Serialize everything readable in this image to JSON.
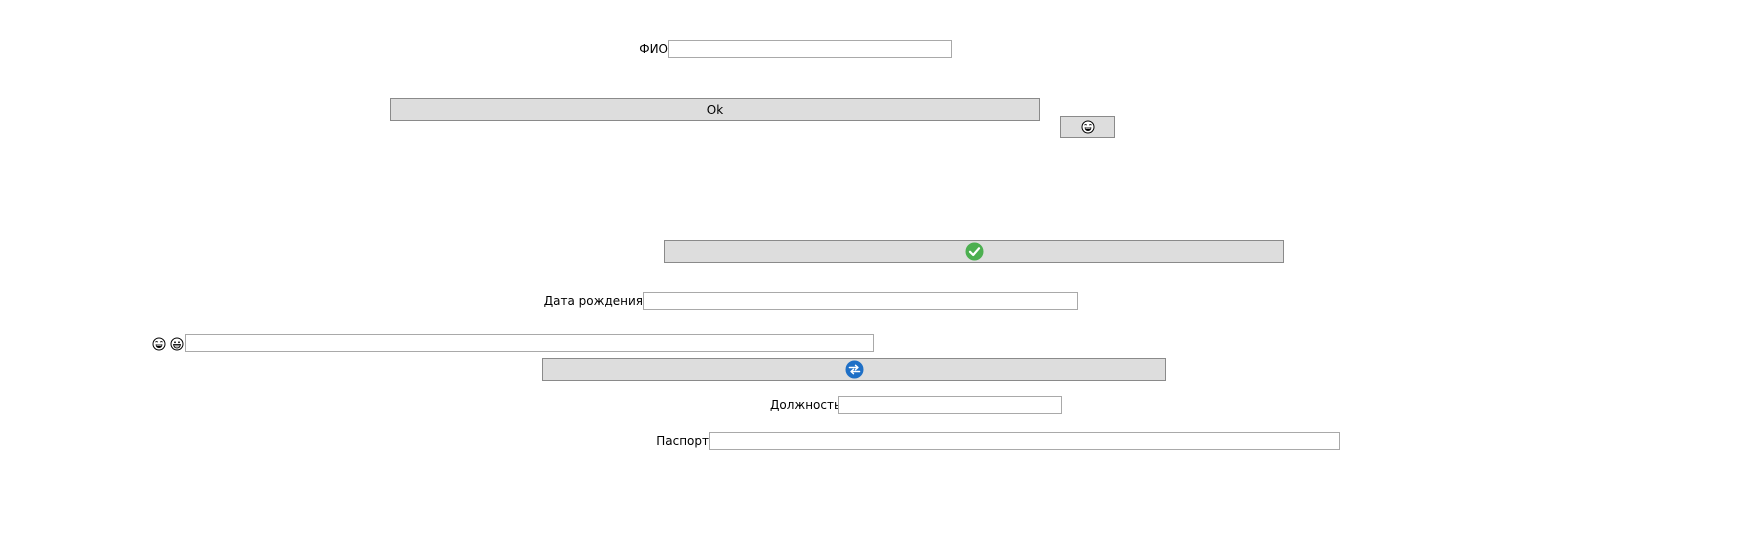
{
  "form": {
    "fio_label": "ФИО",
    "fio_value": "",
    "ok_button_label": "Ok",
    "birth_date_label": "Дата рождения",
    "birth_date_value": "",
    "emoji_field_value": "",
    "position_label": "Должность",
    "position_value": "",
    "passport_label": "Паспорт",
    "passport_value": ""
  },
  "icons": {
    "smiley_button_icon": "laughing-face-icon",
    "check_button_icon": "green-checkmark-icon",
    "refresh_button_icon": "blue-refresh-icon",
    "label_emoji_1": "laughing-face-icon",
    "label_emoji_2": "grinning-face-icon"
  },
  "colors": {
    "button_bg": "#dddddd",
    "check_green": "#4caf50",
    "refresh_blue": "#1e6fc6"
  }
}
